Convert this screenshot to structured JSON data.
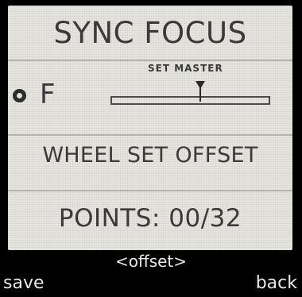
{
  "screen": {
    "title": "SYNC FOCUS",
    "sync_row": {
      "indicator_icon": "circle-icon",
      "letter": "F",
      "slider_label": "SET MASTER",
      "slider_value_fraction": 0.56
    },
    "wheel_label": "WHEEL SET OFFSET",
    "points_label": "POINTS: 00/32"
  },
  "softkeys": {
    "center": "<offset>",
    "left": "save",
    "right": "back"
  },
  "colors": {
    "screen_bg": "#e6e5df",
    "text": "#3a3a3a",
    "bezel": "#000000",
    "softkey_text": "#e8e8e8"
  }
}
